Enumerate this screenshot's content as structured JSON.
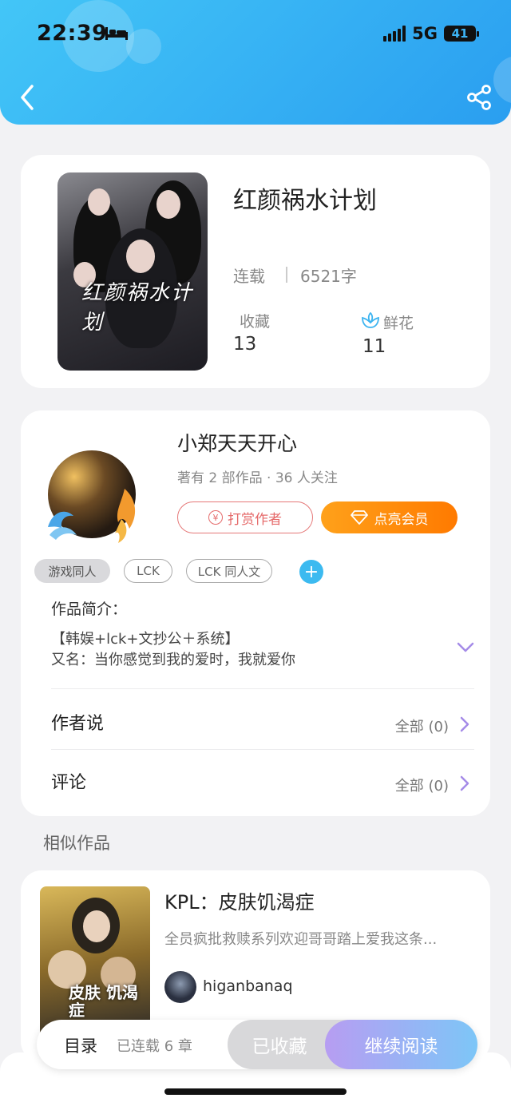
{
  "status_bar": {
    "time": "22:39",
    "network": "5G",
    "battery": "41"
  },
  "book": {
    "title": "红颜祸水计划",
    "cover_text": "红颜祸水计划",
    "status": "连载",
    "word_count": "6521字",
    "favorites_label": "收藏",
    "favorites_value": "13",
    "flowers_label": "鲜花",
    "flowers_value": "11"
  },
  "author": {
    "name": "小郑天天开心",
    "meta": "著有 2 部作品 · 36 人关注",
    "tip_label": "打赏作者",
    "vip_label": "点亮会员"
  },
  "tags": [
    "游戏同人",
    "LCK",
    "LCK 同人文"
  ],
  "intro": {
    "heading": "作品简介：",
    "line1": "【韩娱+lck+文抄公＋系统】",
    "line2": "又名：当你感觉到我的爱时，我就爱你"
  },
  "rows": {
    "author_says_label": "作者说",
    "author_says_value": "全部 (0)",
    "comments_label": "评论",
    "comments_value": "全部 (0)"
  },
  "similar": {
    "heading": "相似作品",
    "title": "KPL：皮肤饥渴症",
    "cover_text": "皮肤 饥渴症",
    "description": "全员疯批救赎系列欢迎哥哥踏上爱我这条...",
    "author": "higanbanaq"
  },
  "bottom_bar": {
    "toc_label": "目录",
    "chapters": "已连载 6 章",
    "collected_label": "已收藏",
    "read_label": "继续阅读"
  },
  "colors": {
    "header_start": "#43c6f7",
    "header_end": "#2a9ef0",
    "vip_orange": "#ff8a00",
    "tip_red": "#e56a6a",
    "read_gradient_start": "#b79df2",
    "read_gradient_end": "#7dc6f7",
    "accent_purple": "#a58be8"
  }
}
